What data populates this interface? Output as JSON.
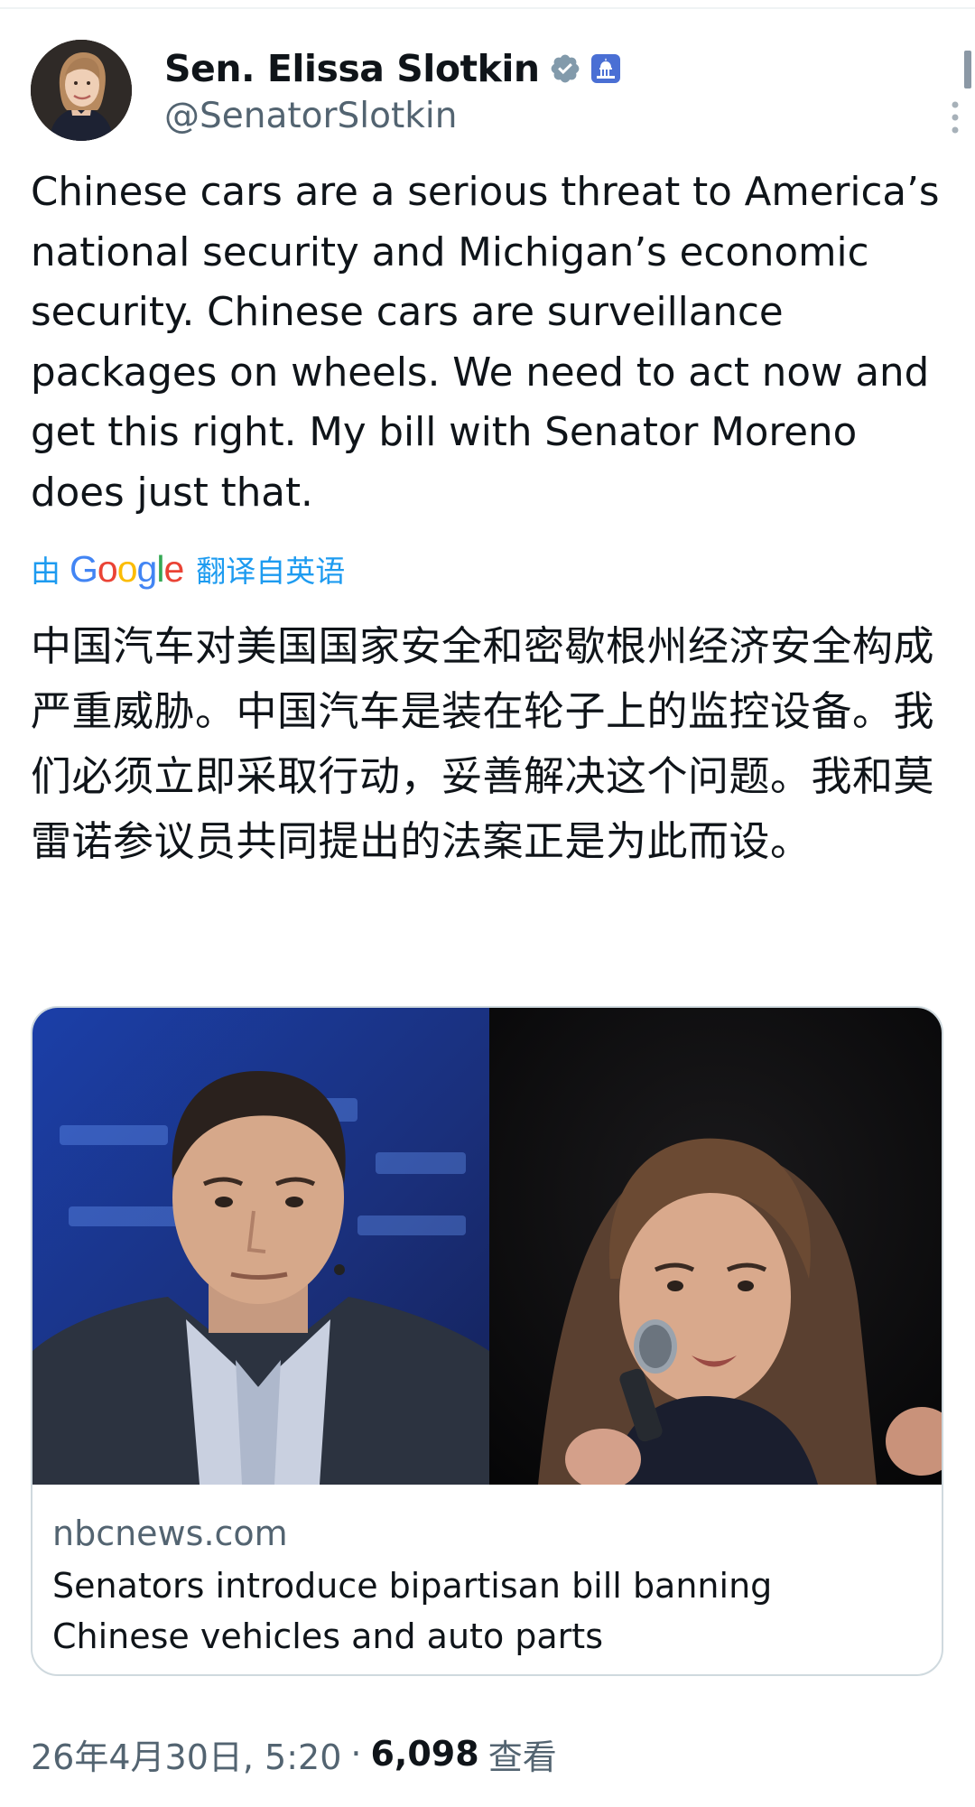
{
  "author": {
    "display_name": "Sen. Elissa Slotkin",
    "handle": "@SenatorSlotkin",
    "verified_badge_icon": "verified-badge-icon",
    "government_badge_icon": "us-capitol-icon"
  },
  "tweet": {
    "text": "Chinese cars are a serious threat to America’s national security and Michigan’s economic security. Chinese cars are surveillance packages on wheels. We need to act now and get this right. My bill with Senator Moreno does just that.",
    "translation": {
      "by_label": "由",
      "provider": "Google",
      "suffix_label": "翻译自英语",
      "text": "中国汽车对美国国家安全和密歇根州经济安全构成严重威胁。中国汽车是装在轮子上的监控设备。我们必须立即采取行动，妥善解决这个问题。我和莫雷诺参议员共同提出的法案正是为此而设。"
    }
  },
  "link_card": {
    "domain": "nbcnews.com",
    "title": "Senators introduce bipartisan bill banning Chinese vehicles and auto parts"
  },
  "footer": {
    "timestamp": "26年4月30日, 5:20",
    "separator": "·",
    "views_count": "6,098",
    "views_label": "查看"
  },
  "colors": {
    "text_primary": "#0f1419",
    "text_secondary": "#536471",
    "accent_blue": "#1d9bf0",
    "border": "#cfd9de"
  }
}
